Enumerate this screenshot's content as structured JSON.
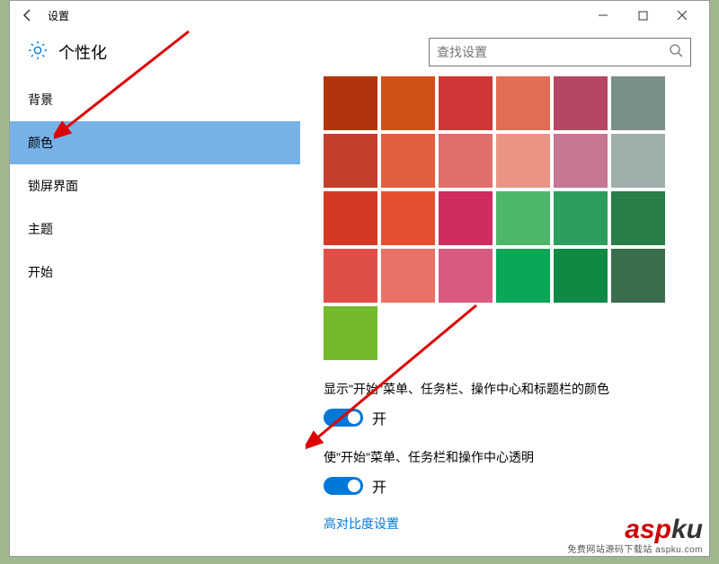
{
  "titlebar": {
    "title": "设置"
  },
  "header": {
    "heading": "个性化"
  },
  "search": {
    "placeholder": "查找设置"
  },
  "sidebar": {
    "items": [
      {
        "label": "背景",
        "selected": false
      },
      {
        "label": "颜色",
        "selected": true
      },
      {
        "label": "锁屏界面",
        "selected": false
      },
      {
        "label": "主题",
        "selected": false
      },
      {
        "label": "开始",
        "selected": false
      }
    ]
  },
  "colors": [
    "#b1340f",
    "#d15017",
    "#ce3637",
    "#e16d56",
    "#b54664",
    "#7a8e8a",
    "#c2402d",
    "#e25e3e",
    "#e06e6b",
    "#ea9484",
    "#c67592",
    "#9fb0ac",
    "#d33a26",
    "#e55130",
    "#cf2c60",
    "#4eb668",
    "#2b9d5c",
    "#297e49",
    "#e04e4a",
    "#e87266",
    "#d85a80",
    "#0aa759",
    "#0f8a45",
    "#3a6d4b",
    "#73b92c"
  ],
  "settings": {
    "show_color_label": "显示\"开始\"菜单、任务栏、操作中心和标题栏的颜色",
    "show_color_state": "开",
    "transparency_label": "使\"开始\"菜单、任务栏和操作中心透明",
    "transparency_state": "开",
    "high_contrast_link": "高对比度设置"
  },
  "watermark": {
    "brand1": "asp",
    "brand2": "ku",
    "tagline": "免费网站源码下载站 aspku.com"
  }
}
